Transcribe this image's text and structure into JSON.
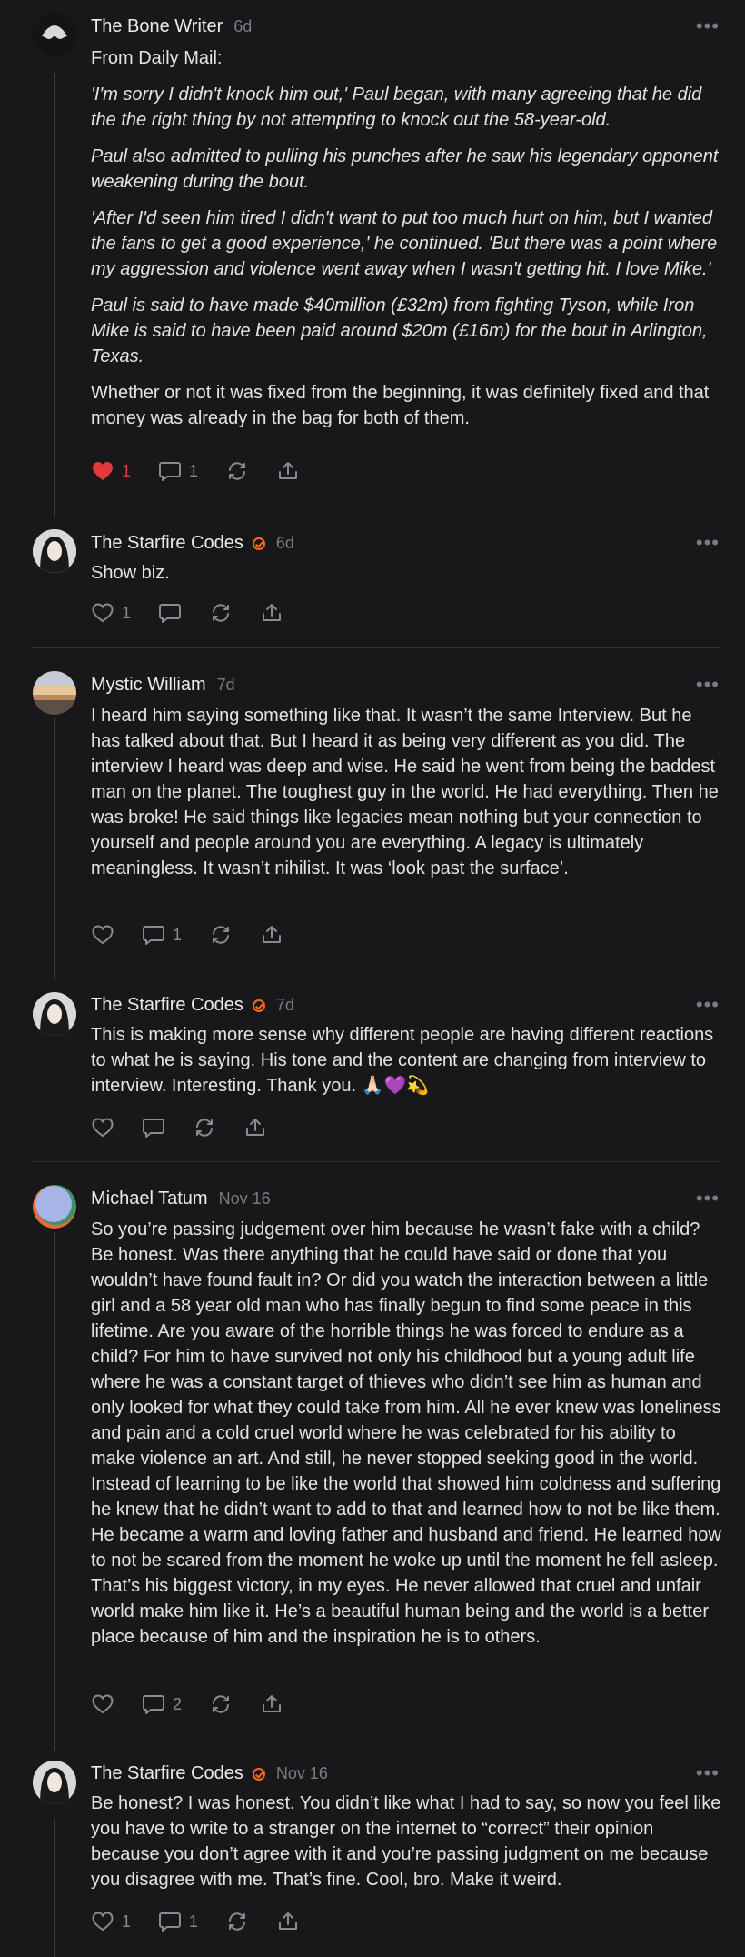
{
  "comments": [
    {
      "author": "The Bone Writer",
      "time": "6d",
      "verified": false,
      "paragraphs": [
        {
          "text": "From Daily Mail:",
          "italic": false
        },
        {
          "text": "'I'm sorry I didn't knock him out,' Paul began, with many agreeing that he did the the right thing by not attempting to knock out the 58-year-old.",
          "italic": true
        },
        {
          "text": "Paul also admitted to pulling his punches after he saw his legendary opponent weakening during the bout.",
          "italic": true
        },
        {
          "text": "'After I'd seen him tired I didn't want to put too much hurt on him, but I wanted the fans to get a good experience,' he continued. 'But there was a point where my aggression and violence went away when I wasn't getting hit. I love Mike.'",
          "italic": true
        },
        {
          "text": "Paul is said to have made $40million (£32m) from fighting Tyson, while Iron Mike is said to have been paid around $20m (£16m) for the bout in Arlington, Texas.",
          "italic": true
        },
        {
          "text": "Whether or not it was fixed from the beginning, it was definitely fixed and that money was already in the bag for both of them.",
          "italic": false
        }
      ],
      "likes": "1",
      "liked": true,
      "replies": "1"
    },
    {
      "author": "The Starfire Codes",
      "time": "6d",
      "verified": true,
      "paragraphs": [
        {
          "text": "Show biz.",
          "italic": false
        }
      ],
      "likes": "1",
      "liked": false,
      "replies": ""
    },
    {
      "author": "Mystic William",
      "time": "7d",
      "verified": false,
      "paragraphs": [
        {
          "text": "I heard him saying something like that. It wasn’t the same Interview. But he has talked about that. But I heard it as being very different as you did. The interview I heard was deep and wise. He said he went from being the baddest man on the planet. The toughest guy in the world. He had everything. Then he was broke! He said things like legacies mean nothing but your connection to yourself and people around you are everything. A legacy is ultimately meaningless. It wasn’t nihilist. It was ‘look past the surface’.",
          "italic": false
        }
      ],
      "likes": "",
      "liked": false,
      "replies": "1"
    },
    {
      "author": "The Starfire Codes",
      "time": "7d",
      "verified": true,
      "paragraphs": [
        {
          "text": "This is making more sense why different people are having different reactions to what he is saying. His tone and the content are changing from interview to interview. Interesting. Thank you. 🙏🏻💜💫",
          "italic": false
        }
      ],
      "likes": "",
      "liked": false,
      "replies": ""
    },
    {
      "author": "Michael Tatum",
      "time": "Nov 16",
      "verified": false,
      "paragraphs": [
        {
          "text": "So you’re passing judgement over him because he wasn’t fake with a child? Be honest. Was there anything that he could have said or done that you wouldn’t have found fault in? Or did you watch the interaction between a little girl and a 58 year old man who has finally begun to find some peace in this lifetime. Are you aware of the horrible things he was forced to endure as a child? For him to have survived not only his childhood but a young adult life where he was a constant target of thieves who didn’t see him as human and only looked for what they could take from him. All he ever knew was loneliness and pain and a cold cruel world where he was celebrated for his ability to make violence an art. And still, he never stopped seeking good in the world. Instead of learning to be like the world that showed him coldness and suffering he knew that he didn’t want to add to that and learned how to not be like them. He became a warm and loving father and husband and friend. He learned how to not be scared from the moment he woke up until the moment he fell asleep. That’s his biggest victory, in my eyes. He never allowed that cruel and unfair world make him like it. He’s a beautiful human being and the world is a better place because of him and the inspiration he is to others.",
          "italic": false
        }
      ],
      "likes": "",
      "liked": false,
      "replies": "2"
    },
    {
      "author": "The Starfire Codes",
      "time": "Nov 16",
      "verified": true,
      "paragraphs": [
        {
          "text": "Be honest? I was honest. You didn’t like what I had to say, so now you feel like you have to write to a stranger on the internet to “correct” their opinion because you don’t agree with it and you’re passing judgment on me because you disagree with me. That’s fine. Cool, bro. Make it weird.",
          "italic": false
        }
      ],
      "likes": "1",
      "liked": false,
      "replies": "1"
    }
  ]
}
